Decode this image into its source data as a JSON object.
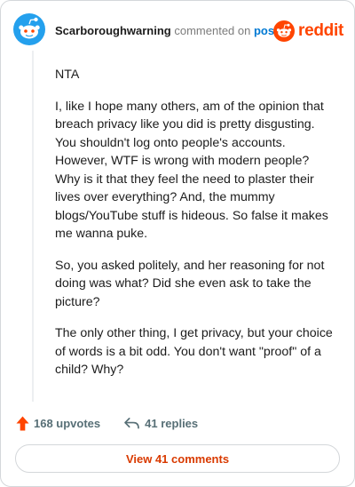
{
  "comment": {
    "username": "Scarboroughwarning",
    "action_text": "commented on",
    "post_link": "post",
    "brand": "reddit",
    "paragraphs": [
      "NTA",
      "I, like I hope many others, am of the opinion that breach privacy like you did is pretty disgusting. You shouldn't log onto people's accounts. However, WTF is wrong with modern people? Why is it that they feel the need to plaster their lives over everything? And, the mummy blogs/YouTube stuff is hideous. So false it makes me wanna puke.",
      "So, you asked politely, and her reasoning for not doing was what? Did she even ask to take the picture?",
      "The only other thing, I get privacy, but your choice of words is a bit odd. You don't want \"proof\" of a child? Why?"
    ]
  },
  "actions": {
    "upvotes": "168 upvotes",
    "replies": "41 replies"
  },
  "view_comments_label": "View 41 comments",
  "colors": {
    "brand_orange": "#ff4500",
    "link_blue": "#0079d3",
    "avatar_teal": "#24a0ed",
    "button_text": "#d93a00"
  },
  "icons": [
    "snoo-avatar-icon",
    "reddit-logo-icon",
    "upvote-arrow-icon",
    "reply-arrow-icon"
  ]
}
